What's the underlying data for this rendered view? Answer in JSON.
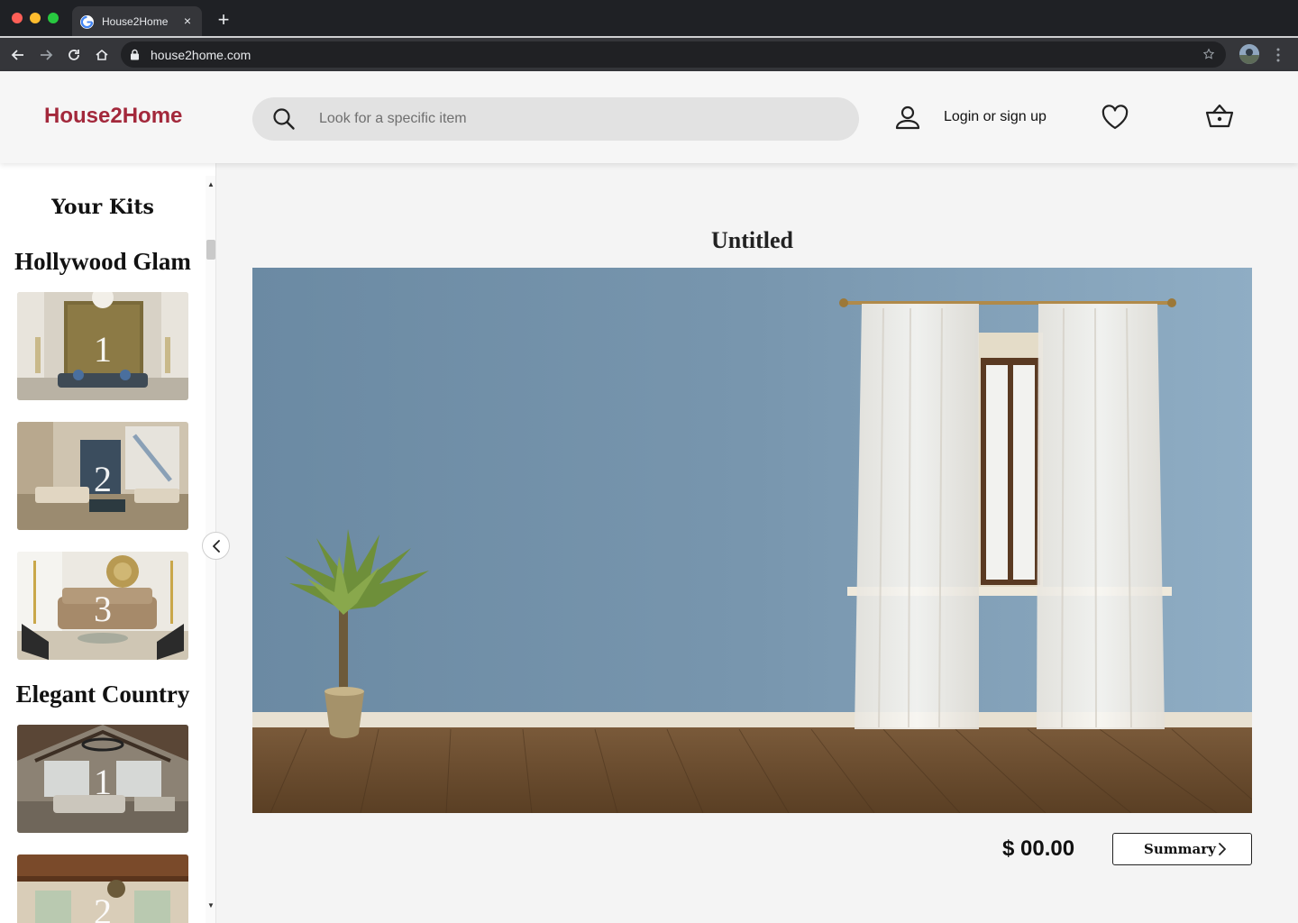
{
  "browser": {
    "tab_title": "House2Home",
    "url": "house2home.com",
    "new_tab_symbol": "+",
    "close_symbol": "×"
  },
  "header": {
    "logo": "House2Home",
    "search_placeholder": "Look for a specific item",
    "login_label": "Login or sign up",
    "brand_color": "#a3283b"
  },
  "sidebar": {
    "title": "Your Kits",
    "groups": [
      {
        "name": "Hollywood Glam",
        "kits": [
          "1",
          "2",
          "3"
        ]
      },
      {
        "name": "Elegant Country",
        "kits": [
          "1",
          "2"
        ]
      }
    ]
  },
  "main": {
    "title": "Untitled",
    "price": "$ 00.00",
    "summary_label": "Summary"
  },
  "icons": [
    "search-icon",
    "user-icon",
    "heart-icon",
    "basket-icon",
    "chevron-left-icon",
    "chevron-right-icon",
    "lock-icon",
    "star-icon"
  ]
}
